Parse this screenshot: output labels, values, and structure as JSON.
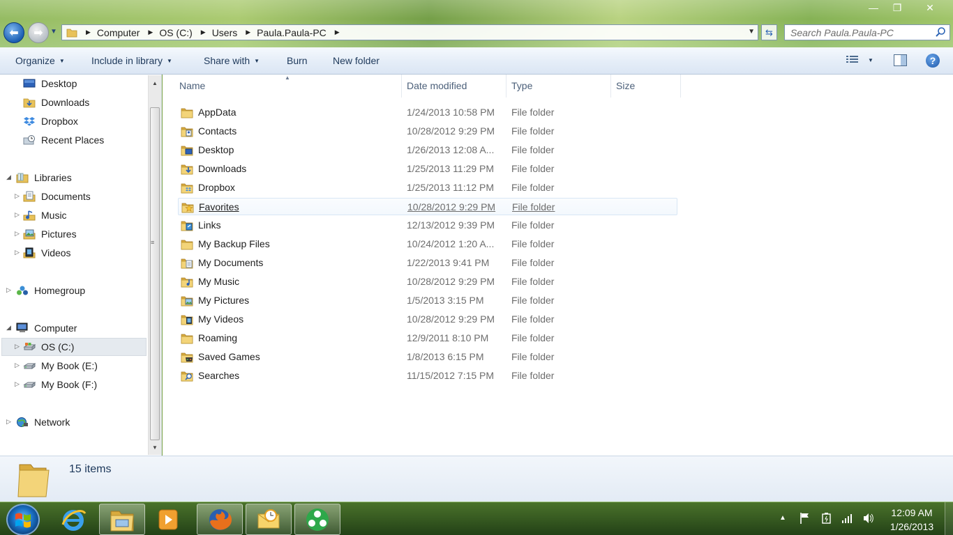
{
  "window": {
    "minimize": "—",
    "maximize": "❐",
    "close": "✕"
  },
  "address": {
    "crumbs": [
      "Computer",
      "OS (C:)",
      "Users",
      "Paula.Paula-PC"
    ],
    "search_placeholder": "Search Paula.Paula-PC"
  },
  "toolbar": {
    "organize": "Organize",
    "include_in_library": "Include in library",
    "share_with": "Share with",
    "burn": "Burn",
    "new_folder": "New folder"
  },
  "nav": {
    "favorites": [
      "Desktop",
      "Downloads",
      "Dropbox",
      "Recent Places"
    ],
    "libraries": "Libraries",
    "library_items": [
      "Documents",
      "Music",
      "Pictures",
      "Videos"
    ],
    "homegroup": "Homegroup",
    "computer": "Computer",
    "drives": [
      "OS (C:)",
      "My Book (E:)",
      "My Book (F:)"
    ],
    "network": "Network",
    "selected": "OS (C:)"
  },
  "columns": {
    "name": "Name",
    "date_modified": "Date modified",
    "type": "Type",
    "size": "Size"
  },
  "files": [
    {
      "name": "AppData",
      "date": "1/24/2013 10:58 PM",
      "type": "File folder",
      "icon": "folder-icon"
    },
    {
      "name": "Contacts",
      "date": "10/28/2012 9:29 PM",
      "type": "File folder",
      "icon": "contacts-folder-icon"
    },
    {
      "name": "Desktop",
      "date": "1/26/2013 12:08 A...",
      "type": "File folder",
      "icon": "desktop-folder-icon"
    },
    {
      "name": "Downloads",
      "date": "1/25/2013 11:29 PM",
      "type": "File folder",
      "icon": "downloads-folder-icon"
    },
    {
      "name": "Dropbox",
      "date": "1/25/2013 11:12 PM",
      "type": "File folder",
      "icon": "dropbox-folder-icon"
    },
    {
      "name": "Favorites",
      "date": "10/28/2012 9:29 PM",
      "type": "File folder",
      "icon": "favorites-folder-icon"
    },
    {
      "name": "Links",
      "date": "12/13/2012 9:39 PM",
      "type": "File folder",
      "icon": "links-folder-icon"
    },
    {
      "name": "My Backup Files",
      "date": "10/24/2012 1:20 A...",
      "type": "File folder",
      "icon": "folder-icon"
    },
    {
      "name": "My Documents",
      "date": "1/22/2013 9:41 PM",
      "type": "File folder",
      "icon": "documents-folder-icon"
    },
    {
      "name": "My Music",
      "date": "10/28/2012 9:29 PM",
      "type": "File folder",
      "icon": "music-folder-icon"
    },
    {
      "name": "My Pictures",
      "date": "1/5/2013 3:15 PM",
      "type": "File folder",
      "icon": "pictures-folder-icon"
    },
    {
      "name": "My Videos",
      "date": "10/28/2012 9:29 PM",
      "type": "File folder",
      "icon": "videos-folder-icon"
    },
    {
      "name": "Roaming",
      "date": "12/9/2011 8:10 PM",
      "type": "File folder",
      "icon": "folder-icon"
    },
    {
      "name": "Saved Games",
      "date": "1/8/2013 6:15 PM",
      "type": "File folder",
      "icon": "saved-games-folder-icon"
    },
    {
      "name": "Searches",
      "date": "11/15/2012 7:15 PM",
      "type": "File folder",
      "icon": "searches-folder-icon"
    }
  ],
  "hovered_file": "Favorites",
  "status": {
    "item_count": "15 items"
  },
  "taskbar": {
    "apps": [
      "internet-explorer-icon",
      "windows-explorer-icon",
      "media-player-icon",
      "firefox-icon",
      "outlook-icon",
      "green-app-icon"
    ],
    "clock_time": "12:09 AM",
    "clock_date": "1/26/2013"
  },
  "colors": {
    "folder": "#e8c25a",
    "accent": "#1e395b",
    "secondary_text": "#6d6d6d"
  }
}
